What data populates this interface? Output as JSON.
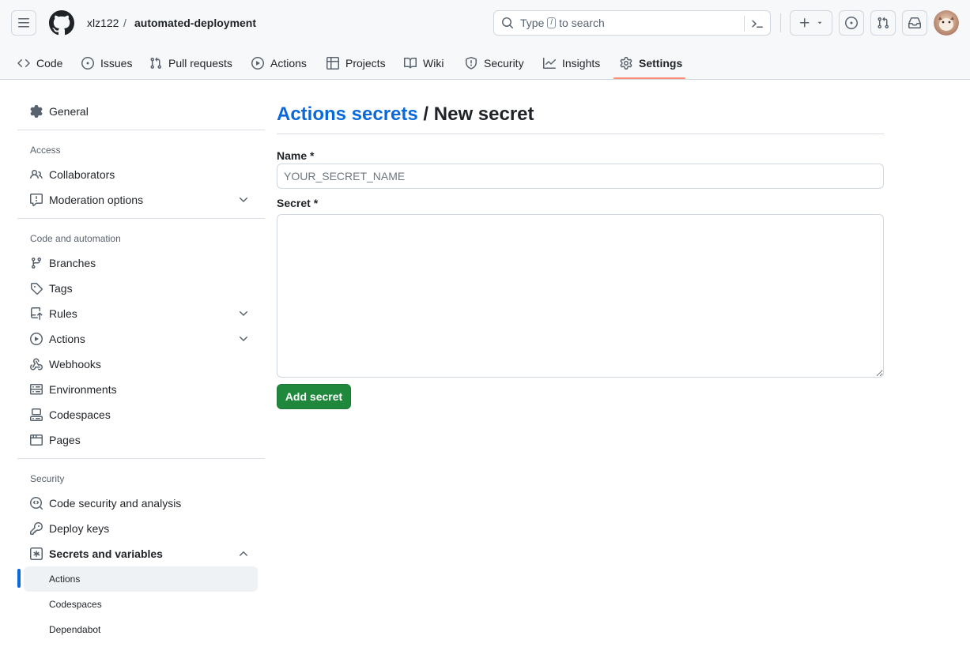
{
  "header": {
    "owner": "xlz122",
    "separator": "/",
    "repo": "automated-deployment",
    "search": {
      "prefix": "Type",
      "key": "/",
      "suffix": "to search"
    }
  },
  "tabs": [
    {
      "label": "Code",
      "icon": "code-icon"
    },
    {
      "label": "Issues",
      "icon": "issue-icon"
    },
    {
      "label": "Pull requests",
      "icon": "pull-request-icon"
    },
    {
      "label": "Actions",
      "icon": "play-icon"
    },
    {
      "label": "Projects",
      "icon": "table-icon"
    },
    {
      "label": "Wiki",
      "icon": "book-icon"
    },
    {
      "label": "Security",
      "icon": "shield-icon"
    },
    {
      "label": "Insights",
      "icon": "graph-icon"
    },
    {
      "label": "Settings",
      "icon": "gear-icon",
      "selected": true
    }
  ],
  "sidebar": {
    "general": "General",
    "access_heading": "Access",
    "collaborators": "Collaborators",
    "moderation": "Moderation options",
    "code_heading": "Code and automation",
    "branches": "Branches",
    "tags": "Tags",
    "rules": "Rules",
    "actions": "Actions",
    "webhooks": "Webhooks",
    "environments": "Environments",
    "codespaces": "Codespaces",
    "pages": "Pages",
    "security_heading": "Security",
    "code_security": "Code security and analysis",
    "deploy_keys": "Deploy keys",
    "secrets": "Secrets and variables",
    "sub_items": [
      "Actions",
      "Codespaces",
      "Dependabot"
    ],
    "active_sub_item": "Actions"
  },
  "main": {
    "breadcrumb_link": "Actions secrets",
    "breadcrumb_sep": " / ",
    "title": "New secret",
    "name_label": "Name *",
    "name_placeholder": "YOUR_SECRET_NAME",
    "secret_label": "Secret *",
    "secret_value": "",
    "submit": "Add secret"
  },
  "colors": {
    "accent": "#0969da",
    "primary_button": "#1f883d",
    "selected_tab_underline": "#fd8c73"
  }
}
